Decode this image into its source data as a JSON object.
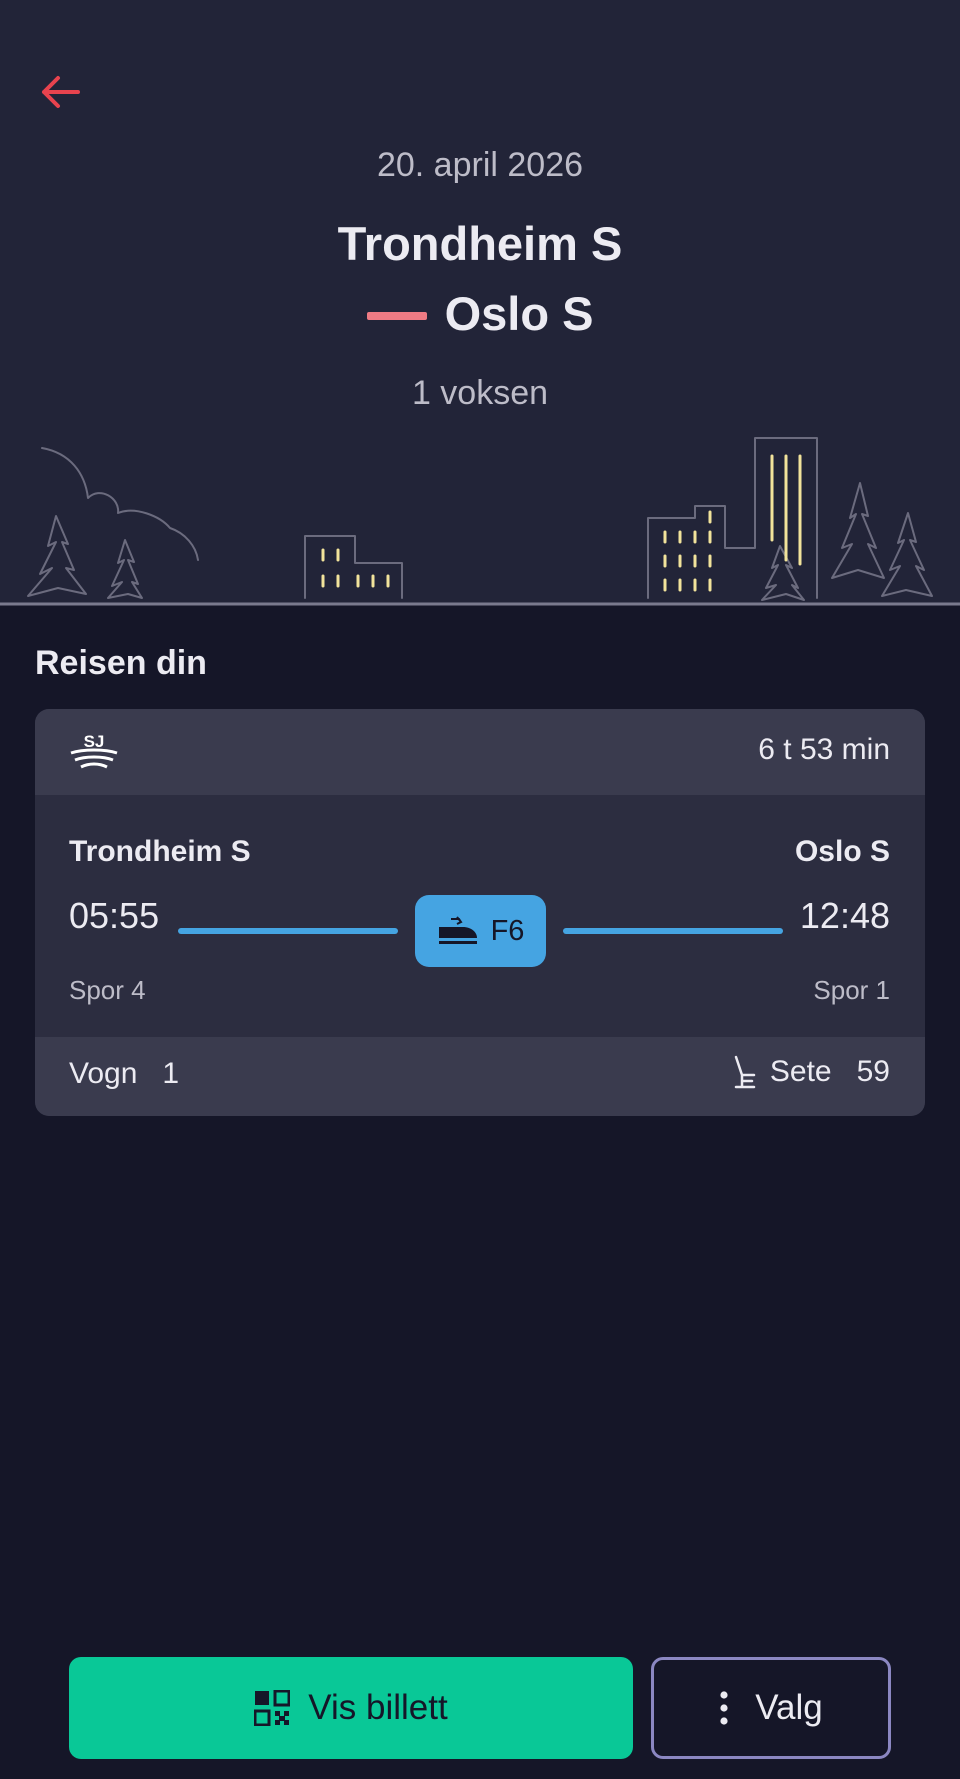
{
  "header": {
    "back_icon": "arrow-left-icon",
    "date": "20. april 2026",
    "from": "Trondheim S",
    "to": "Oslo S",
    "passengers": "1 voksen"
  },
  "colors": {
    "hero_bg": "#222438",
    "page_bg": "#151628",
    "accent_red": "#e8434e",
    "route_pink": "#ef7b84",
    "line_blue": "#45a4e2",
    "primary_green": "#09c897",
    "outline_purple": "#8b87c2",
    "window_yellow": "#f2e39b"
  },
  "journey": {
    "section_title": "Reisen din",
    "operator_icon": "sj-logo",
    "duration": "6 t 53 min",
    "departure_station": "Trondheim S",
    "arrival_station": "Oslo S",
    "departure_time": "05:55",
    "arrival_time": "12:48",
    "train_icon": "train-icon",
    "train_line": "F6",
    "departure_track": "Spor 4",
    "arrival_track": "Spor 1",
    "wagon": "Vogn   1",
    "seat_icon": "seat-icon",
    "seat": "Sete   59"
  },
  "actions": {
    "ticket_icon": "qr-code-icon",
    "ticket_label": "Vis billett",
    "options_icon": "more-vertical-icon",
    "options_label": "Valg"
  }
}
